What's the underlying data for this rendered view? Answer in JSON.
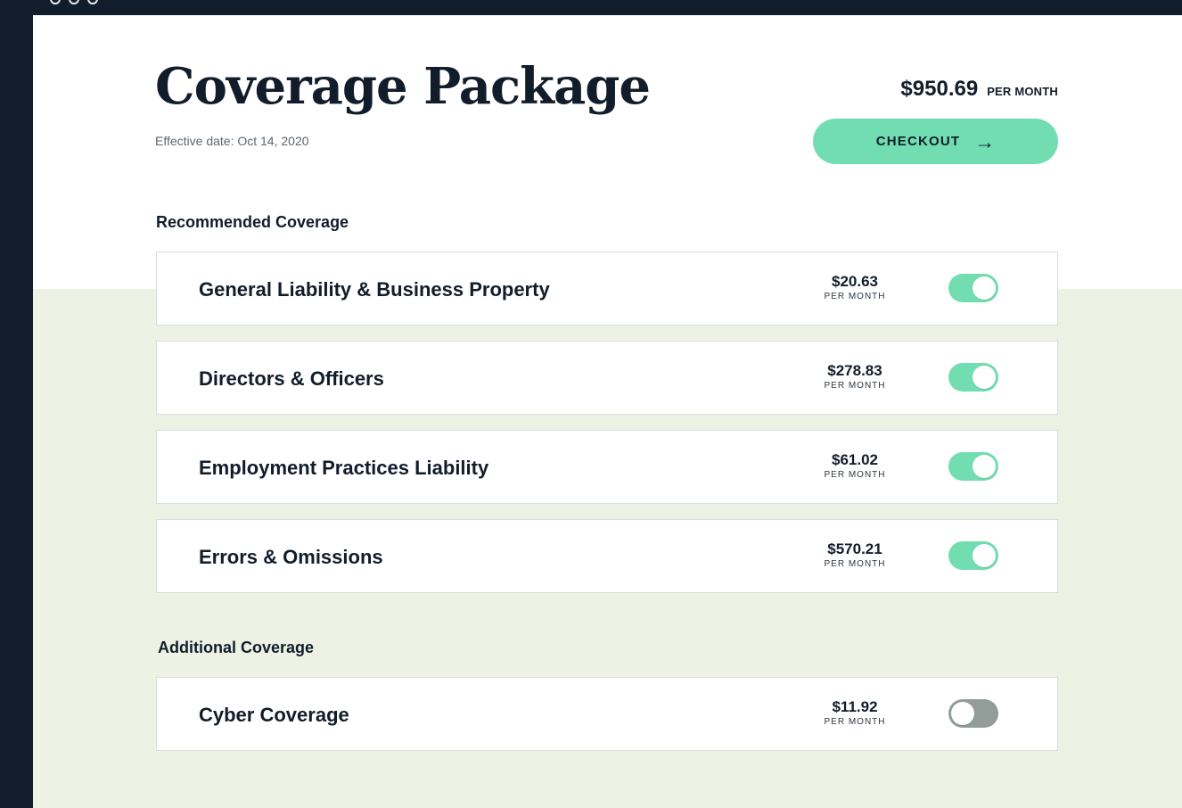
{
  "colors": {
    "navy": "#121d2b",
    "accent": "#72ddb1",
    "background_tint": "#eef2e5",
    "toggle_off": "#929d99"
  },
  "header": {
    "title": "Coverage Package",
    "effective_date": "Effective date: Oct 14, 2020",
    "total_price": "$950.69",
    "total_unit": "PER MONTH",
    "checkout_label": "CHECKOUT",
    "checkout_icon": "arrow-right-icon"
  },
  "recommended": {
    "title": "Recommended Coverage",
    "items": [
      {
        "name": "General Liability & Business Property",
        "price": "$20.63",
        "unit": "PER MONTH",
        "enabled": true
      },
      {
        "name": "Directors & Officers",
        "price": "$278.83",
        "unit": "PER MONTH",
        "enabled": true
      },
      {
        "name": "Employment Practices Liability",
        "price": "$61.02",
        "unit": "PER MONTH",
        "enabled": true
      },
      {
        "name": "Errors & Omissions",
        "price": "$570.21",
        "unit": "PER MONTH",
        "enabled": true
      }
    ]
  },
  "additional": {
    "title": "Additional Coverage",
    "items": [
      {
        "name": "Cyber Coverage",
        "price": "$11.92",
        "unit": "PER MONTH",
        "enabled": false
      }
    ]
  }
}
